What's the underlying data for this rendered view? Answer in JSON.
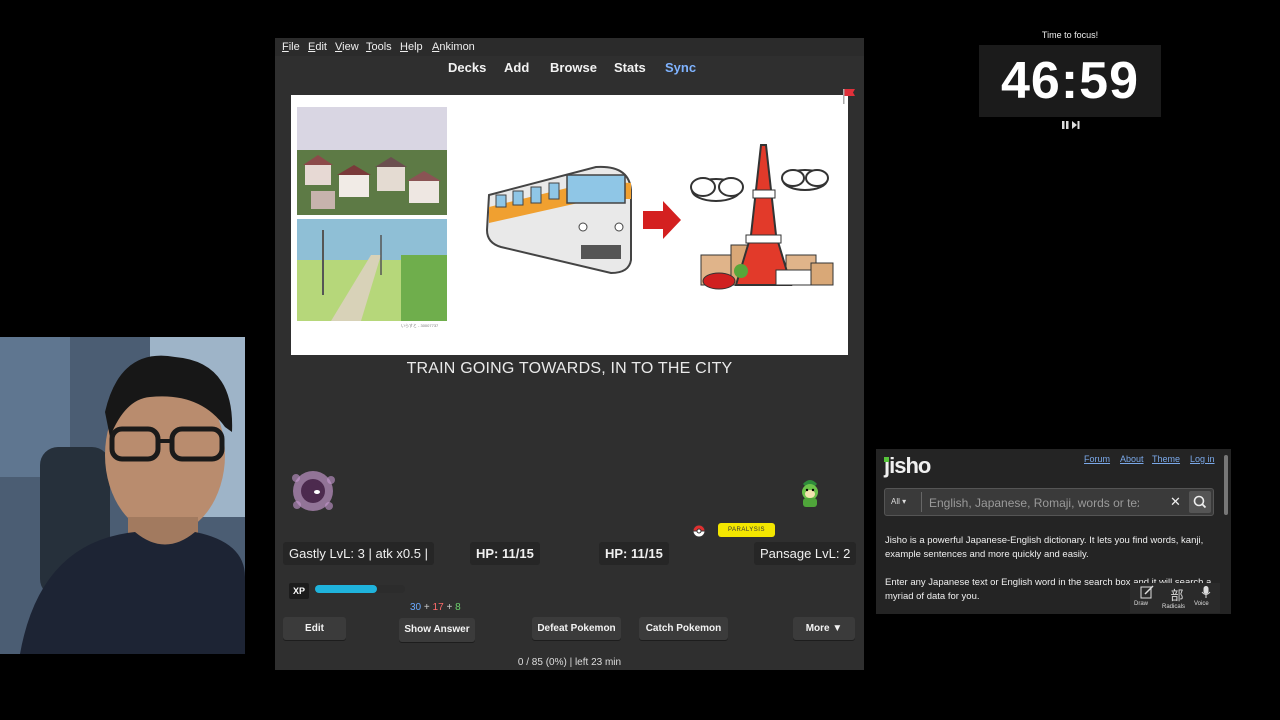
{
  "menu": [
    "File",
    "Edit",
    "View",
    "Tools",
    "Help",
    "Ankimon"
  ],
  "toolbar": {
    "decks": "Decks",
    "add": "Add",
    "browse": "Browse",
    "stats": "Stats",
    "sync": "Sync"
  },
  "card": {
    "answer": "TRAIN GOING TOWARDS, IN TO THE CITY",
    "caption": "いらすと - 30007737"
  },
  "battle": {
    "player_stats": "Gastly LvL: 3 | atk x0.5 |",
    "player_hp": "HP: 11/15",
    "enemy_hp": "HP: 11/15",
    "enemy_stats": "Pansage LvL: 2",
    "status": "PARALYSIS",
    "xp_label": "XP",
    "xp_fraction": 0.69
  },
  "counts": {
    "new": "30",
    "plus1": "+",
    "learn": "17",
    "plus2": "+",
    "review": "8"
  },
  "buttons": {
    "edit": "Edit",
    "show_answer": "Show Answer",
    "defeat": "Defeat Pokemon",
    "catch": "Catch Pokemon",
    "more": "More ▼"
  },
  "progress": "0 / 85 (0%) | left 23 min",
  "timer": {
    "title": "Time to focus!",
    "value": "46:59"
  },
  "jisho": {
    "logo": "jisho",
    "nav": [
      "Forum",
      "About",
      "Theme",
      "Log in"
    ],
    "filter": "All ▾",
    "placeholder": "English, Japanese, Romaji, words or text",
    "intro": "Jisho is a powerful Japanese-English dictionary. It lets you find words, kanji, example sentences and more quickly and easily.",
    "intro2": "Enter any Japanese text or English word in the search box and it will search a myriad of data for you.",
    "tools": [
      "Draw",
      "Radicals",
      "Voice"
    ]
  },
  "colors": {
    "accent_sync": "#7fb3ff",
    "xp_bar": "#1fb3dc",
    "status_badge": "#f3e600"
  }
}
